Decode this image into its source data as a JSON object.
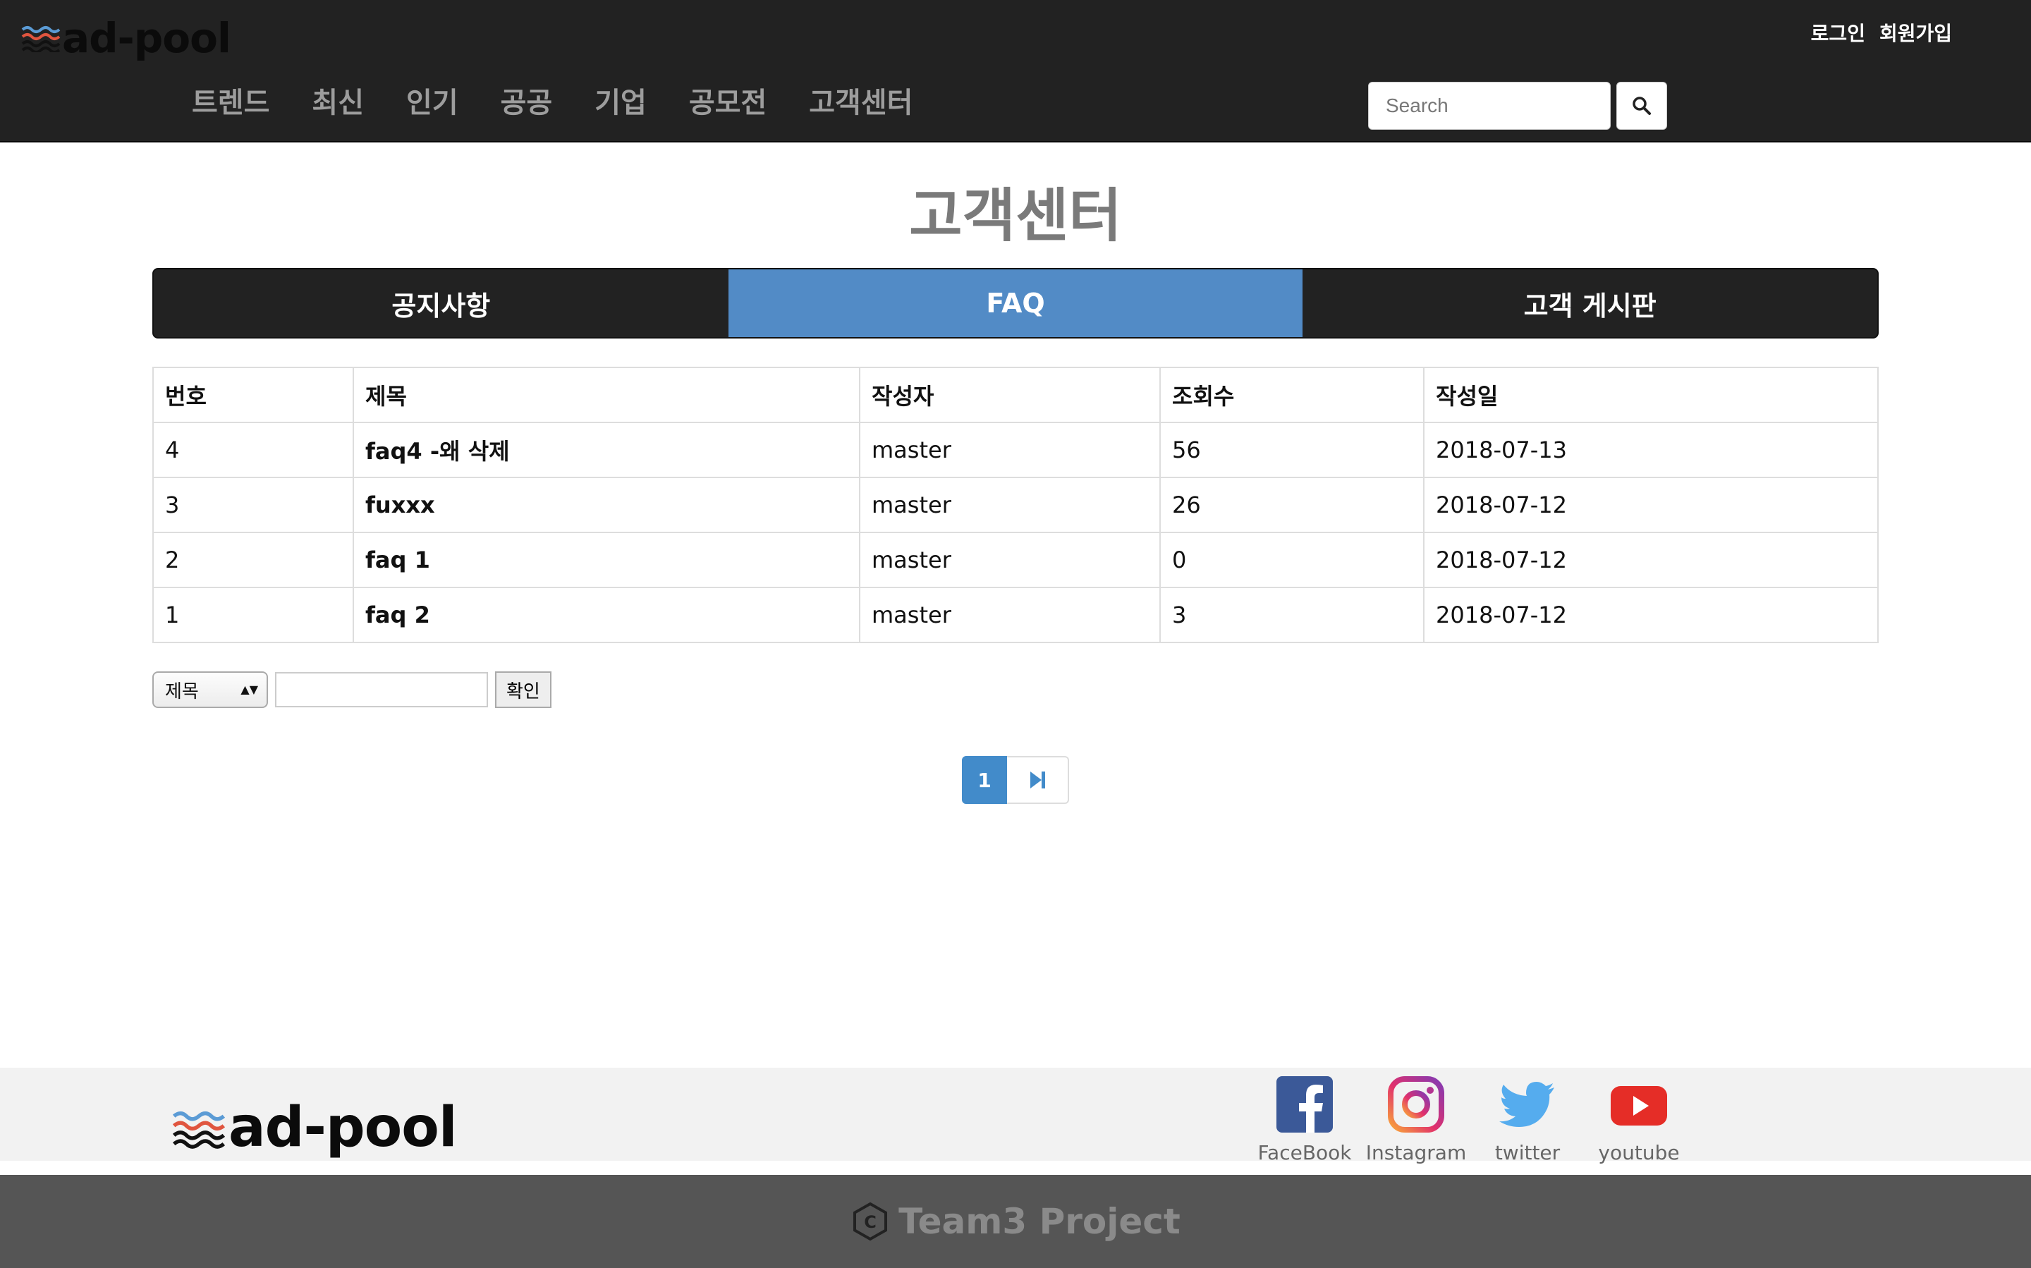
{
  "header": {
    "logo_text": "ad-pool",
    "auth": {
      "login": "로그인",
      "signup": "회원가입"
    },
    "nav": [
      "트렌드",
      "최신",
      "인기",
      "공공",
      "기업",
      "공모전",
      "고객센터"
    ],
    "search": {
      "placeholder": "Search"
    }
  },
  "main": {
    "title": "고객센터",
    "tabs": [
      {
        "label": "공지사항",
        "active": false
      },
      {
        "label": "FAQ",
        "active": true
      },
      {
        "label": "고객 게시판",
        "active": false
      }
    ],
    "table": {
      "columns": [
        "번호",
        "제목",
        "작성자",
        "조회수",
        "작성일"
      ],
      "rows": [
        {
          "no": "4",
          "title": "faq4 -왜 삭제",
          "author": "master",
          "views": "56",
          "date": "2018-07-13"
        },
        {
          "no": "3",
          "title": "fuxxx",
          "author": "master",
          "views": "26",
          "date": "2018-07-12"
        },
        {
          "no": "2",
          "title": "faq 1",
          "author": "master",
          "views": "0",
          "date": "2018-07-12"
        },
        {
          "no": "1",
          "title": "faq 2",
          "author": "master",
          "views": "3",
          "date": "2018-07-12"
        }
      ]
    },
    "board_search": {
      "field": "제목",
      "submit": "확인"
    },
    "pagination": {
      "current": "1"
    }
  },
  "footer": {
    "logo_text": "ad-pool",
    "social": [
      {
        "icon": "facebook-icon",
        "label": "FaceBook"
      },
      {
        "icon": "instagram-icon",
        "label": "Instagram"
      },
      {
        "icon": "twitter-icon",
        "label": "twitter"
      },
      {
        "icon": "youtube-icon",
        "label": "youtube"
      }
    ],
    "copyright": "Team3 Project"
  },
  "colors": {
    "header_bg": "#222222",
    "accent": "#528bc6",
    "footer_bg": "#f2f2f2",
    "bottom_bg": "#555555"
  }
}
